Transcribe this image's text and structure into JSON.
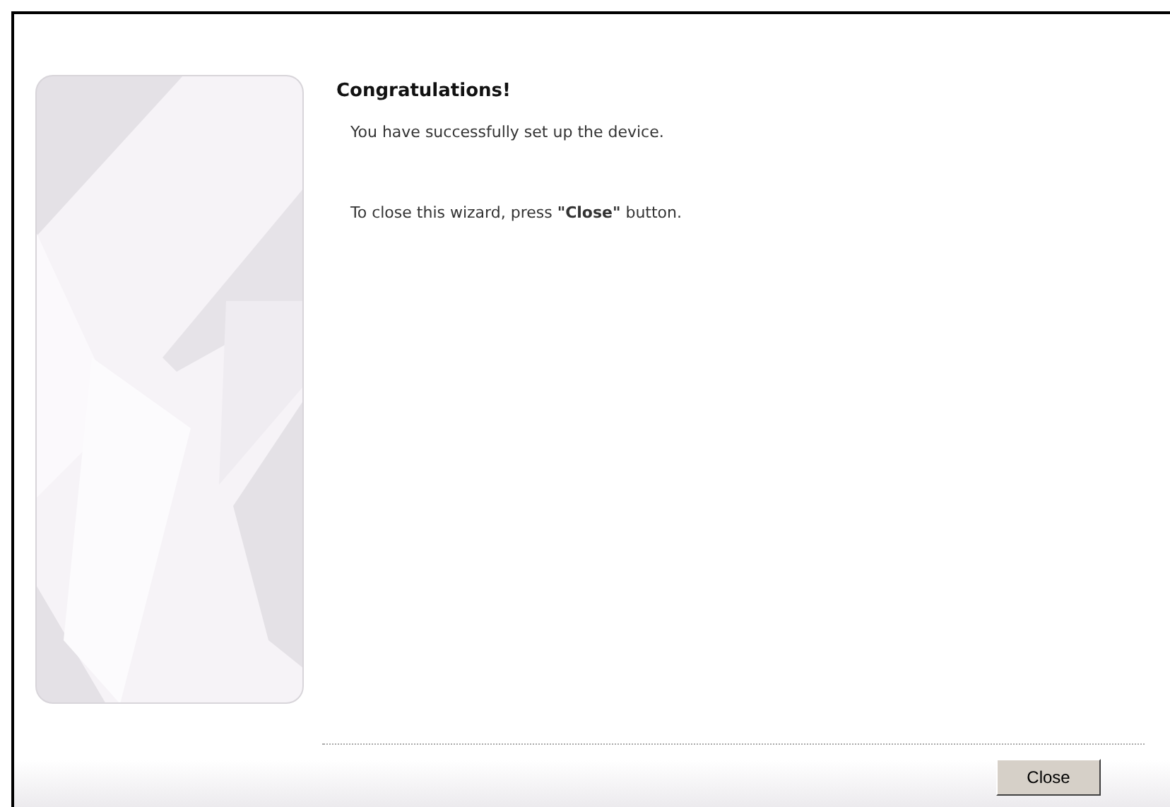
{
  "heading": "Congratulations!",
  "messages": [
    "You have successfully set up the device.",
    "To close this wizard, press **\"Close\"** button."
  ],
  "buttons": [
    "Close"
  ]
}
